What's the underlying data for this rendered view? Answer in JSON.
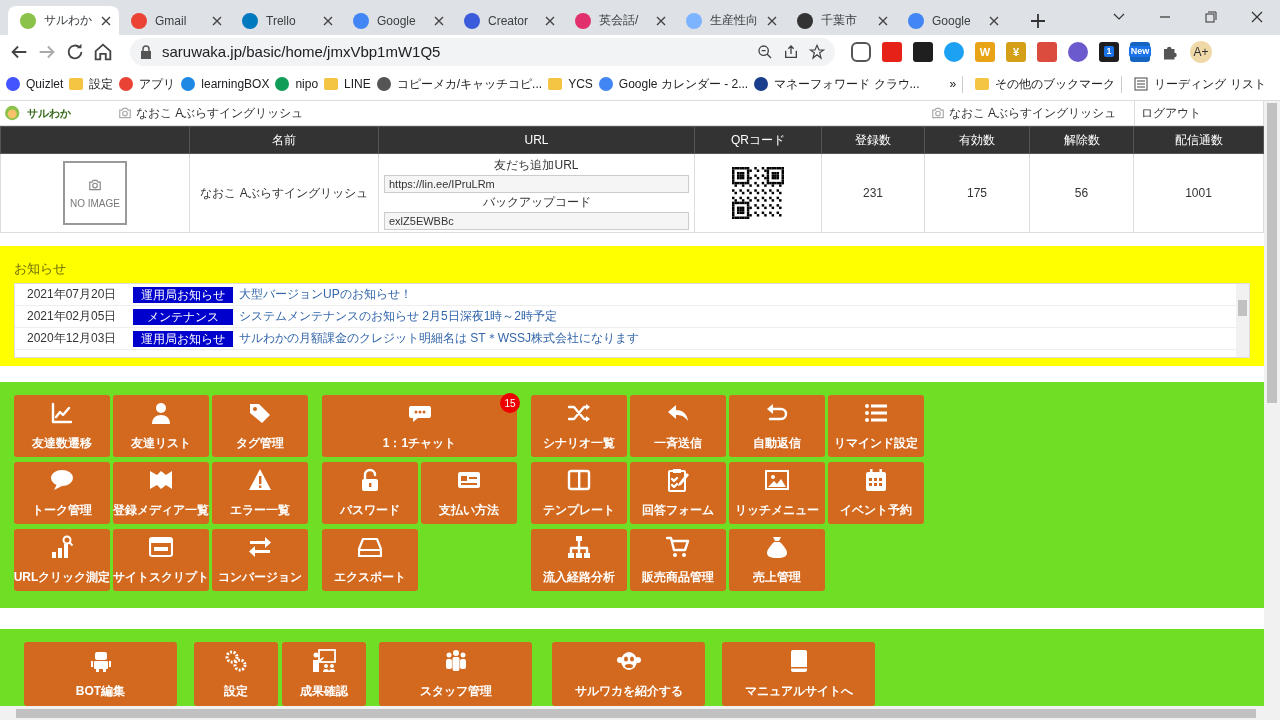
{
  "browser": {
    "tabs": [
      {
        "title": "サルわか",
        "selected": true
      },
      {
        "title": "Gmail",
        "selected": false
      },
      {
        "title": "Trello",
        "selected": false
      },
      {
        "title": "Google",
        "selected": false
      },
      {
        "title": "Creator",
        "selected": false
      },
      {
        "title": "英会話/",
        "selected": false
      },
      {
        "title": "生産性向",
        "selected": false
      },
      {
        "title": "千葉市",
        "selected": false
      },
      {
        "title": "Google",
        "selected": false
      }
    ],
    "address": "saruwaka.jp/basic/home/jmxVbp1mW1Q5",
    "extensions": [
      {
        "text": "W"
      },
      {
        "text": "¥"
      },
      {
        "text": "1"
      },
      {
        "text": "New"
      }
    ],
    "profile": "A+",
    "bookmarks": [
      "Quizlet",
      "設定",
      "アプリ",
      "learningBOX",
      "nipo",
      "LINE",
      "コピーメカ/キャッチコピ...",
      "YCS",
      "Google カレンダー - 2...",
      "マネーフォワード クラウ..."
    ],
    "bookmarks_more": "»",
    "other_bookmarks": "その他のブックマーク",
    "reading_list": "リーディング リスト"
  },
  "header": {
    "logo": "サルわか",
    "account_name": "なおこ Aぶらすイングリッシュ",
    "account_name_right": "なおこ Aぶらすイングリッシュ",
    "logout": "ログアウト"
  },
  "account_table": {
    "columns": [
      "名前",
      "URL",
      "QRコード",
      "登録数",
      "有効数",
      "解除数",
      "配信通数"
    ],
    "no_image": "NO IMAGE",
    "name": "なおこ Aぶらすイングリッシュ",
    "friend_url_label": "友だち追加URL",
    "friend_url": "https://lin.ee/IPruLRm",
    "backup_label": "バックアップコード",
    "backup_code": "exlZ5EWBBc",
    "registered": "231",
    "active": "175",
    "cancelled": "56",
    "deliveries": "1001"
  },
  "notices": {
    "title": "お知らせ",
    "items": [
      {
        "date": "2021年07月20日",
        "category": "運用局お知らせ",
        "text": "大型バージョンUPのお知らせ！"
      },
      {
        "date": "2021年02月05日",
        "category": "メンテナンス",
        "text": "システムメンテナンスのお知らせ 2月5日深夜1時～2時予定"
      },
      {
        "date": "2020年12月03日",
        "category": "運用局お知らせ",
        "text": "サルわかの月額課金のクレジット明細名は ST＊WSSJ株式会社になります"
      }
    ]
  },
  "menu_groups": [
    {
      "tiles": [
        {
          "label": "友達数遷移"
        },
        {
          "label": "友達リスト"
        },
        {
          "label": "タグ管理"
        },
        {
          "label": "トーク管理"
        },
        {
          "label": "登録メディア一覧"
        },
        {
          "label": "エラー一覧"
        },
        {
          "label": "URLクリック測定"
        },
        {
          "label": "サイトスクリプト"
        },
        {
          "label": "コンバージョン"
        }
      ]
    },
    {
      "tiles": [
        {
          "label": "1：1チャット",
          "badge": "15"
        },
        {
          "label": "パスワード"
        },
        {
          "label": "支払い方法"
        },
        {
          "label": "エクスポート"
        }
      ]
    },
    {
      "tiles": [
        {
          "label": "シナリオ一覧"
        },
        {
          "label": "一斉送信"
        },
        {
          "label": "自動返信"
        },
        {
          "label": "リマインド設定"
        },
        {
          "label": "テンプレート"
        },
        {
          "label": "回答フォーム"
        },
        {
          "label": "リッチメニュー"
        },
        {
          "label": "イベント予約"
        },
        {
          "label": "流入経路分析"
        },
        {
          "label": "販売商品管理"
        },
        {
          "label": "売上管理"
        }
      ]
    }
  ],
  "bottom_menu": [
    {
      "label": "BOT編集"
    },
    {
      "label": "設定"
    },
    {
      "label": "成果確認"
    },
    {
      "label": "スタッフ管理"
    },
    {
      "label": "サルワカを紹介する"
    },
    {
      "label": "マニュアルサイトへ"
    }
  ]
}
